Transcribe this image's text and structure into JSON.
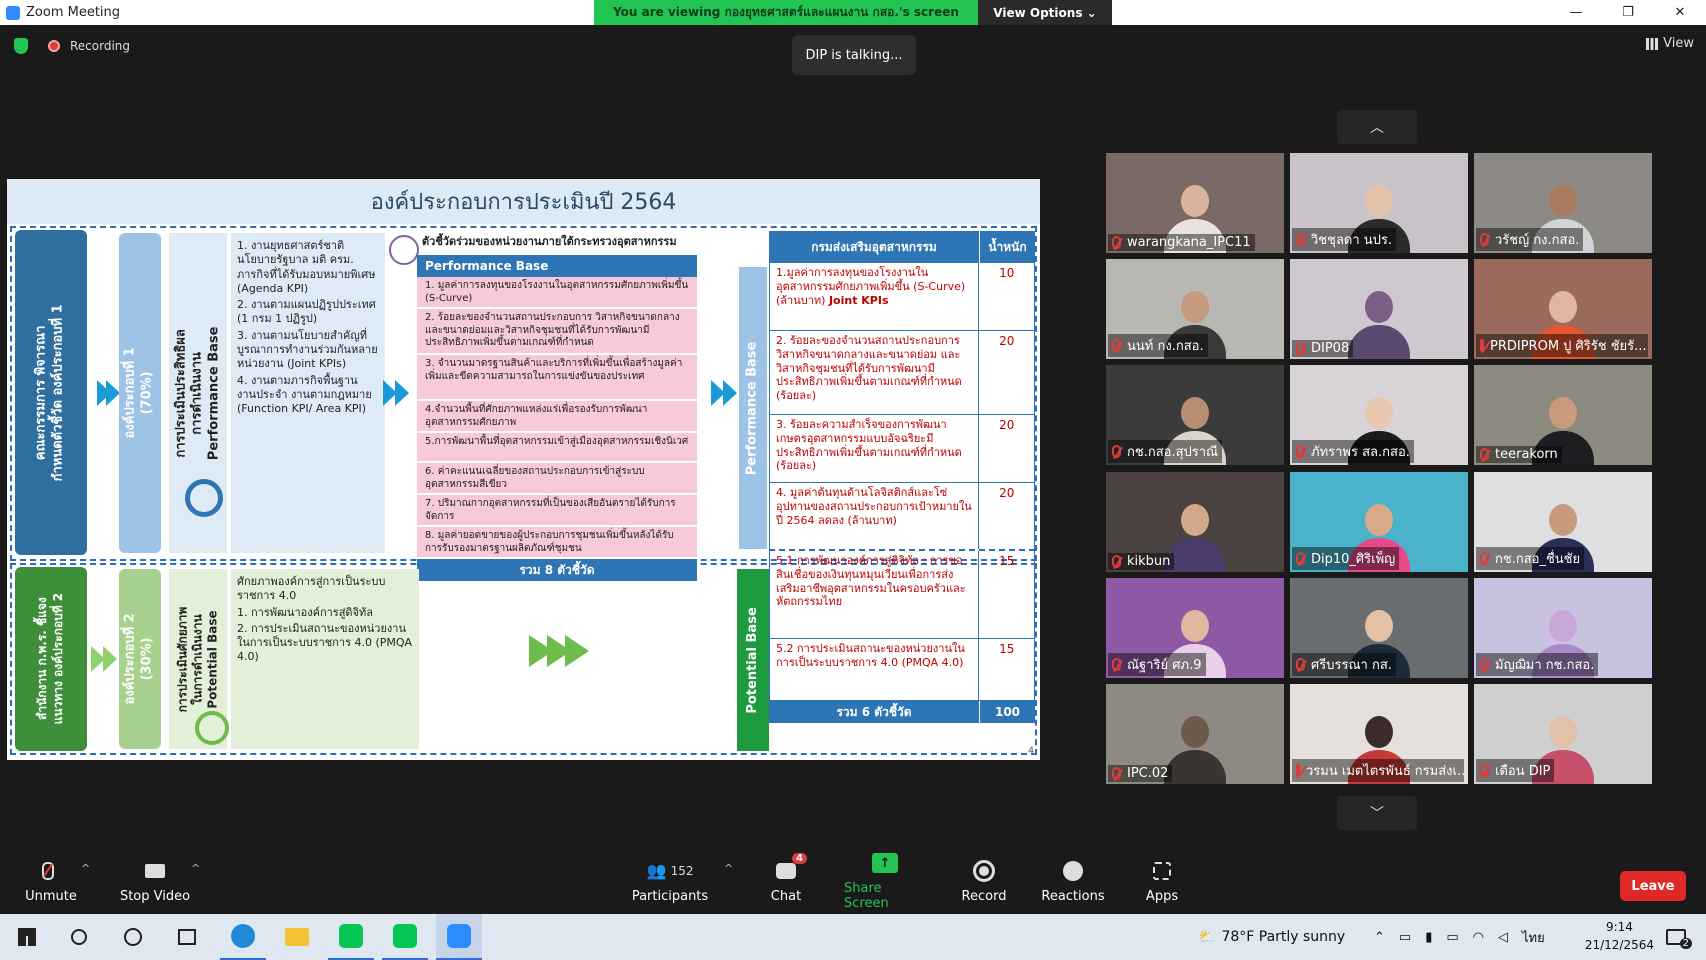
{
  "window": {
    "title": "Zoom Meeting",
    "minimize": "—",
    "restore": "❐",
    "close": "✕"
  },
  "banner": {
    "message": "You are viewing กองยุทธศาสตร์และแผนงาน กสอ.'s screen",
    "view_options": "View Options ⌄"
  },
  "status": {
    "recording": "Recording",
    "talking": "DIP is talking...",
    "view": "View"
  },
  "slide": {
    "title": "องค์ประกอบการประเมินปี 2564",
    "left_bar_1": "คณะกรรมการ พิจารณา\nกำหนดตัวชี้วัด องค์ประกอบที่ 1",
    "comp1": "องค์ประกอบที่ 1\n(70%)",
    "perf_base_label": "การประเมินประสิทธิผล\nการดำเนินงาน\nPerformance Base",
    "list1": [
      "1. งานยุทธศาสตร์ชาติ นโยบายรัฐบาล มติ ครม. ภารกิจที่ได้รับมอบหมายพิเศษ (Agenda KPI)",
      "2. งานตามแผนปฏิรูปประเทศ (1 กรม 1 ปฏิรูป)",
      "3. งานตามนโยบายสำคัญที่บูรณาการทำงานร่วมกันหลายหน่วยงาน (Joint KPIs)",
      "4. งานตามภารกิจพื้นฐาน งานประจำ งานตามกฎหมาย (Function KPI/ Area KPI)"
    ],
    "pb_caption": "ตัวชี้วัดร่วมของหน่วยงานภายใต้กระทรวงอุตสาหกรรม",
    "pb_header": "Performance Base",
    "pb_rows": [
      "1. มูลค่าการลงทุนของโรงงานในอุตสาหกรรมศักยภาพเพิ่มขึ้น (S-Curve)",
      "2. ร้อยละของจำนวนสถานประกอบการ วิสาหกิจขนาดกลางและขนาดย่อมและวิสาหกิจชุมชนที่ได้รับการพัฒนามีประสิทธิภาพเพิ่มขึ้นตามเกณฑ์ที่กำหนด",
      "3. จำนวนมาตรฐานสินค้าและบริการที่เพิ่มขึ้นเพื่อสร้างมูลค่าเพิ่มและขีดความสามารถในการแข่งขันของประเทศ",
      "4.จำนวนพื้นที่ศักยภาพแหล่งแร่เพื่อรองรับการพัฒนาอุตสาหกรรมศักยภาพ",
      "5.การพัฒนาพื้นที่อุตสาหกรรมเข้าสู่เมืองอุตสาหกรรมเชิงนิเวศ",
      "6. ค่าคะแนนเฉลี่ยของสถานประกอบการเข้าสู่ระบบอุตสาหกรรมสีเขียว",
      "7. ปริมาณกากอุตสาหกรรมที่เป็นของเสียอันตรายได้รับการจัดการ",
      "8. มูลค่ายอดขายของผู้ประกอบการชุมชนเพิ่มขึ้นหลังได้รับการรับรองมาตรฐานผลิตภัณฑ์ชุมชน"
    ],
    "pb_total": "รวม 8 ตัวชี้วัด",
    "pb_vertical": "Performance Base",
    "dept_header": "กรมส่งเสริมอุตสาหกรรม",
    "weight_header": "น้ำหนัก",
    "dept_rows": [
      {
        "text": "1.มูลค่าการลงทุนของโรงงานในอุตสาหกรรมศักยภาพเพิ่มขึ้น (S-Curve) (ล้านบาท)",
        "tag": "Joint KPIs",
        "w": "10"
      },
      {
        "text": "2. ร้อยละของจำนวนสถานประกอบการวิสาหกิจขนาดกลางและขนาดย่อม และวิสาหกิจชุมชนที่ได้รับการพัฒนามีประสิทธิภาพเพิ่มขึ้นตามเกณฑ์ที่กำหนด (ร้อยละ)",
        "tag": "",
        "w": "20"
      },
      {
        "text": "3. ร้อยละความสำเร็จของการพัฒนาเกษตรอุตสาหกรรมแบบอัจฉริยะมีประสิทธิภาพเพิ่มขึ้นตามเกณฑ์ที่กำหนด (ร้อยละ)",
        "tag": "",
        "w": "20"
      },
      {
        "text": "4. มูลค่าต้นทุนด้านโลจิสติกส์และโซ่อุปทานของสถานประกอบการเป้าหมายในปี 2564 ลดลง (ล้านบาท)",
        "tag": "",
        "w": "20"
      },
      {
        "text": "5.1 การพัฒนาองค์การสู่ดิจิทัล : การขอสินเชื่อของเงินทุนหมุนเวียนเพื่อการส่งเสริมอาชีพอุตสาหกรรมในครอบครัวและหัตถกรรมไทย",
        "tag": "",
        "w": "15"
      },
      {
        "text": "5.2 การประเมินสถานะของหน่วยงานในการเป็นระบบราชการ 4.0 (PMQA 4.0)",
        "tag": "",
        "w": "15"
      }
    ],
    "dept_total": "รวม 6 ตัวชี้วัด",
    "dept_total_w": "100",
    "left_bar_2": "สำนักงาน ก.พ.ร. ชี้แจง\nแนวทาง องค์ประกอบที่ 2",
    "comp2": "องค์ประกอบที่ 2\n(30%)",
    "pot_base_label": "การประเมินศักยภาพ\nในการดำเนินงาน\nPotential Base",
    "list2_title": "ศักยภาพองค์การสู่การเป็นระบบราชการ 4.0",
    "list2": [
      "1. การพัฒนาองค์การสู่ดิจิทัล",
      "2. การประเมินสถานะของหน่วยงานในการเป็นระบบราชการ 4.0 (PMQA 4.0)"
    ],
    "pot_vertical": "Potential Base",
    "page_no": "4"
  },
  "participants_tiles": [
    {
      "name": "warangkana_IPC11",
      "bg": "#7a6a66",
      "skin": "#d9b49c",
      "shirt": "#e9e2de"
    },
    {
      "name": "วิชชุลดา นปร.",
      "bg": "#c9c2c8",
      "skin": "#e4c2aa",
      "shirt": "#2b2b2b"
    },
    {
      "name": "วรัชญ์ กง.กสอ.",
      "bg": "#8d8a86",
      "skin": "#a87a5e",
      "shirt": "#d1d4d6"
    },
    {
      "name": "นนท์ กง.กสอ.",
      "bg": "#b9b7b2",
      "skin": "#c59a7e",
      "shirt": "#3a3a3a"
    },
    {
      "name": "DIP08",
      "bg": "#cfc9cf",
      "skin": "#7a5f86",
      "shirt": "#5a4a70"
    },
    {
      "name": "PRDIPROM ปู ศิริรัช ชัยรั...",
      "bg": "#9c6a5c",
      "skin": "#e1b6a0",
      "shirt": "#e4572e"
    },
    {
      "name": "กช.กสอ.สุปราณี",
      "bg": "#3b3b3b",
      "skin": "#b78d73",
      "shirt": "#d9d3c9"
    },
    {
      "name": "ภัทราพร สล.กสอ.",
      "bg": "#d7d3d7",
      "skin": "#e8c7b0",
      "shirt": "#1b1b1b"
    },
    {
      "name": "teerakorn",
      "bg": "#8d8a80",
      "skin": "#c99b7c",
      "shirt": "#1e1e22"
    },
    {
      "name": "kikbun",
      "bg": "#4a4240",
      "skin": "#d1a88c",
      "shirt": "#4b3c6b"
    },
    {
      "name": "Dip10_ศิริเพ็ญ",
      "bg": "#4ab3c9",
      "skin": "#d9a98a",
      "shirt": "#e64a8a"
    },
    {
      "name": "กช.กสอ_ชื่นชัย",
      "bg": "#dedfe0",
      "skin": "#c89a7c",
      "shirt": "#2a2f5a"
    },
    {
      "name": "ณัฐาริย์ ศภ.9",
      "bg": "#8e5aa6",
      "skin": "#e2b7a0",
      "shirt": "#e8d0e8"
    },
    {
      "name": "ศรีบรรณา กส.",
      "bg": "#6a6d70",
      "skin": "#e3c0a6",
      "shirt": "#1c2a3a"
    },
    {
      "name": "มัญฌิมา กช.กสอ.",
      "bg": "#c8c2e0",
      "skin": "#c8a8d8",
      "shirt": "#a889c9"
    },
    {
      "name": "IPC.02",
      "bg": "#8e8a82",
      "skin": "#6c5a4a",
      "shirt": "#3a3530"
    },
    {
      "name": "วรมน เมตไตรพันธ์ กรมส่งเ...",
      "bg": "#e6e0dc",
      "skin": "#3a2c2a",
      "shirt": "#c73a3a"
    },
    {
      "name": "เดือน DIP",
      "bg": "#cfcfcf",
      "skin": "#e3c0aa",
      "shirt": "#c6506a"
    }
  ],
  "toolbar": {
    "unmute": "Unmute",
    "stop_video": "Stop Video",
    "participants": "Participants",
    "participants_count": "152",
    "chat": "Chat",
    "chat_badge": "4",
    "share_screen": "Share Screen",
    "record": "Record",
    "reactions": "Reactions",
    "apps": "Apps",
    "leave": "Leave"
  },
  "taskbar": {
    "weather": "78°F  Partly sunny",
    "lang": "ไทย",
    "time": "9:14",
    "date": "21/12/2564",
    "notif": "2"
  }
}
